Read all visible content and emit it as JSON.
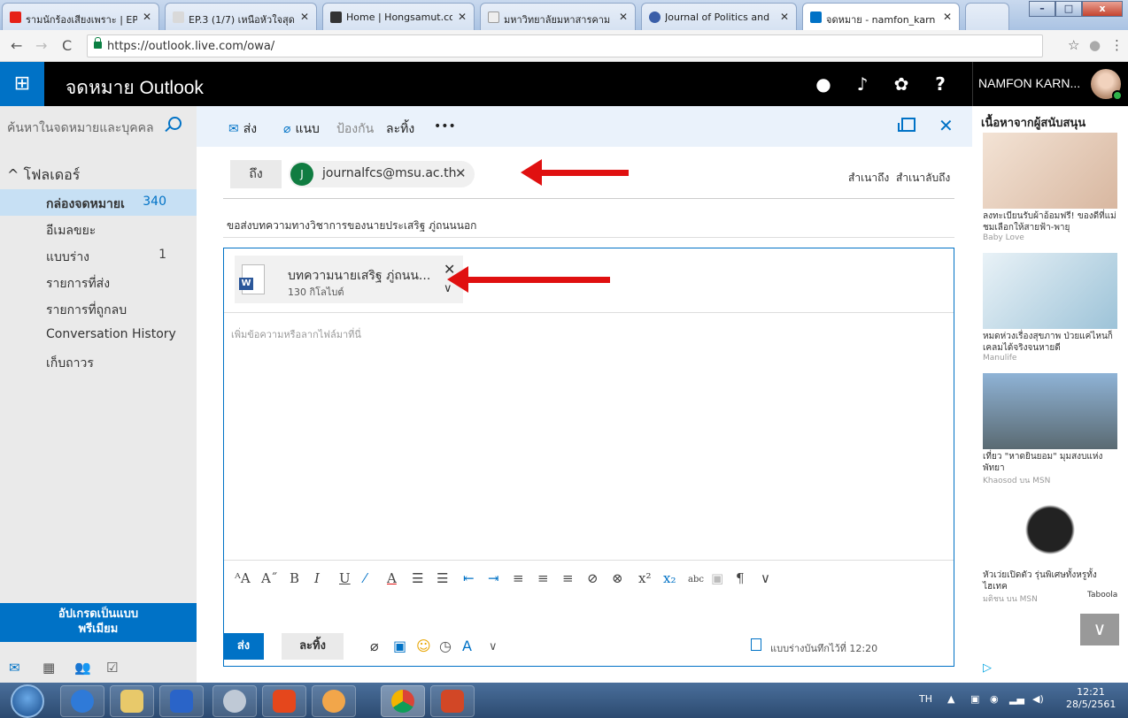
{
  "browser": {
    "tabs": [
      {
        "title": "รามนักร้องเสียงเพราะ | EP",
        "fav_color": "#e62117"
      },
      {
        "title": "EP.3 (1/7) เหนือหัวใจสุด",
        "fav_color": "#d9d9d9"
      },
      {
        "title": "Home | Hongsamut.co",
        "fav_color": "#333333"
      },
      {
        "title": "มหาวิทยาลัยมหาสารคาม M",
        "fav_color": "#eeeeee"
      },
      {
        "title": "Journal of Politics and",
        "fav_color": "#3a5ea8"
      },
      {
        "title": "จดหมาย - namfon_karn",
        "fav_color": "#0072c6"
      }
    ],
    "url": "https://outlook.live.com/owa/",
    "win_min": "–",
    "win_max": "□",
    "win_close": "x"
  },
  "header": {
    "app_title": "จดหมาย Outlook",
    "user_name": "NAMFON KARN..."
  },
  "left_nav": {
    "search_placeholder": "ค้นหาในจดหมายและบุคคล",
    "folders_header": "^ โฟลเดอร์",
    "items": [
      {
        "label": "กล่องจดหมายเ",
        "count": "340"
      },
      {
        "label": "อีเมลขยะ",
        "count": ""
      },
      {
        "label": "แบบร่าง",
        "count": "1"
      },
      {
        "label": "รายการที่ส่ง",
        "count": ""
      },
      {
        "label": "รายการที่ถูกลบ",
        "count": ""
      },
      {
        "label": "Conversation History",
        "count": ""
      },
      {
        "label": "เก็บถาวร",
        "count": ""
      }
    ],
    "upgrade_line1": "อัปเกรดเป็นแบบ",
    "upgrade_line2": "พรีเมียม"
  },
  "compose": {
    "cmd_send": "ส่ง",
    "cmd_attach": "แนบ",
    "cmd_protect": "ป้องกัน",
    "cmd_discard": "ละทิ้ง",
    "cmd_more": "•••",
    "to_label": "ถึง",
    "recipient_initial": "J",
    "recipient_email": "journalfcs@msu.ac.th",
    "cc_label": "สำเนาถึง",
    "bcc_label": "สำเนาลับถึง",
    "subject": "ขอส่งบทความทางวิชาการของนายประเสริฐ ภู่ถนนนอก",
    "attachment_name": "บทความนายเสริฐ ภู่ถนน...",
    "attachment_size": "130 กิโลไบต์",
    "body_placeholder": "เพิ่มข้อความหรือลากไฟล์มาที่นี่",
    "send_button": "ส่ง",
    "discard_button": "ละทิ้ง",
    "saved_status": "แบบร่างบันทึกไว้ที่ 12:20"
  },
  "ads": {
    "header": "เนื้อหาจากผู้สนับสนุน",
    "items": [
      {
        "title": "ลงทะเบียนรับผ้าอ้อมฟรี! ของดีที่แม่ชมเลือกให้สายฟ้า-พายุ",
        "source": "Baby Love",
        "color1": "#f3e3d5",
        "color2": "#d8b7a0"
      },
      {
        "title": "หมดห่วงเรื่องสุขภาพ ป่วยแค่ไหนก็เคลมได้จริงจนหายดี",
        "source": "Manulife",
        "color1": "#e9f2f7",
        "color2": "#9dc3d8"
      },
      {
        "title": "เที่ยว \"หาดยินยอม\" มุมสงบแห่งพัทยา",
        "source": "Khaosod บน MSN",
        "color1": "#8fb3d6",
        "color2": "#5a6a72"
      },
      {
        "title": "หัวเว่ยเปิดตัว รุ่นพิเศษทั้งหรูทั้งไฮเทค",
        "source": "มติชน บน MSN",
        "color1": "#ffffff",
        "color2": "#222222"
      }
    ],
    "taboola": "Taboola"
  },
  "taskbar": {
    "lang": "TH",
    "time": "12:21",
    "date": "28/5/2561"
  }
}
